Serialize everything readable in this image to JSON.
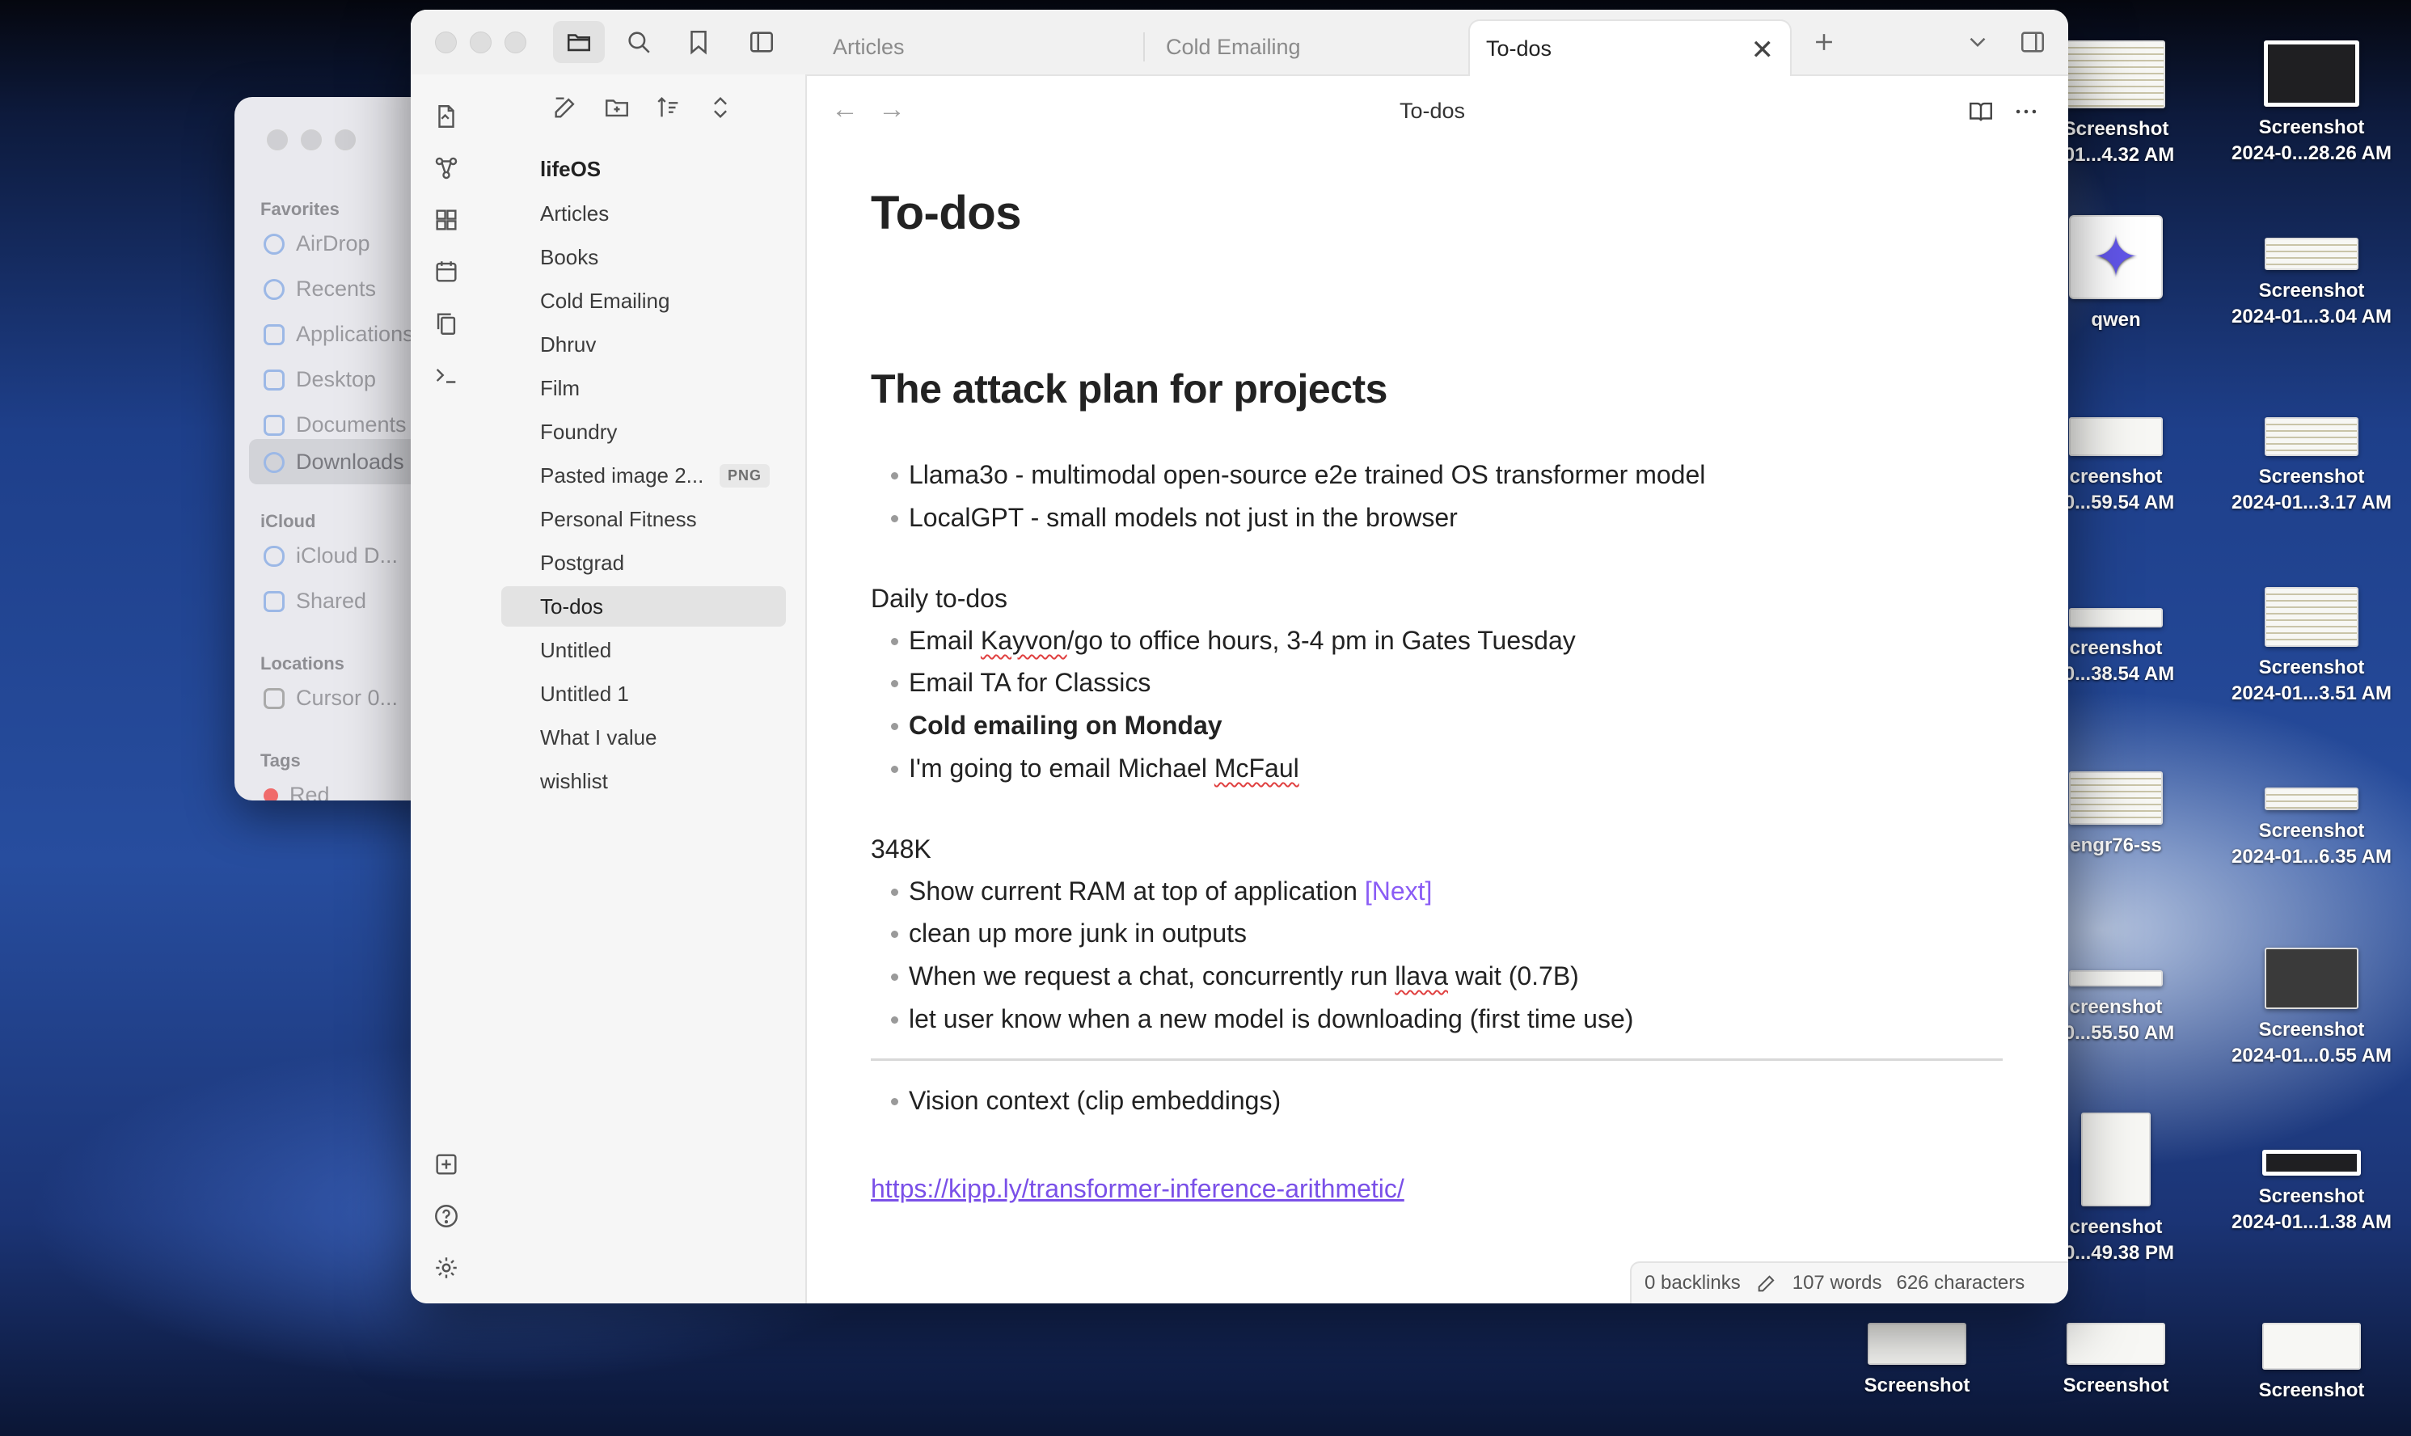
{
  "finder": {
    "sections": {
      "favorites": "Favorites",
      "icloud": "iCloud",
      "locations": "Locations",
      "tags": "Tags"
    },
    "items": {
      "airdrop": "AirDrop",
      "recents": "Recents",
      "applications": "Applications",
      "desktop": "Desktop",
      "documents": "Documents",
      "downloads": "Downloads",
      "icloud_drive": "iCloud D...",
      "shared": "Shared",
      "cursor": "Cursor 0...",
      "red": "Red"
    }
  },
  "desktop_icons": [
    {
      "line1": "Screenshot",
      "line2": "-01...4.32 AM"
    },
    {
      "line1": "Screenshot",
      "line2": "2024-0...28.26 AM"
    },
    {
      "line1": "qwen",
      "line2": ""
    },
    {
      "line1": "Screenshot",
      "line2": "2024-01...3.04 AM"
    },
    {
      "line1": "creenshot",
      "line2": "-0...59.54 AM"
    },
    {
      "line1": "Screenshot",
      "line2": "2024-01...3.17 AM"
    },
    {
      "line1": "creenshot",
      "line2": "-0...38.54 AM"
    },
    {
      "line1": "Screenshot",
      "line2": "2024-01...3.51 AM"
    },
    {
      "line1": "engr76-ss",
      "line2": ""
    },
    {
      "line1": "Screenshot",
      "line2": "2024-01...6.35 AM"
    },
    {
      "line1": "creenshot",
      "line2": "-0...55.50 AM"
    },
    {
      "line1": "Screenshot",
      "line2": "2024-01...0.55 AM"
    },
    {
      "line1": "creenshot",
      "line2": "-0...49.38 PM"
    },
    {
      "line1": "Screenshot",
      "line2": "2024-01...1.38 AM"
    },
    {
      "line1": "Screenshot",
      "line2": ""
    },
    {
      "line1": "Screenshot",
      "line2": ""
    },
    {
      "line1": "Screenshot",
      "line2": ""
    }
  ],
  "tabs": [
    {
      "label": "Articles"
    },
    {
      "label": "Cold Emailing"
    },
    {
      "label": "To-dos"
    }
  ],
  "explorer": {
    "vault_name": "lifeOS",
    "files": [
      {
        "name": "Articles"
      },
      {
        "name": "Books"
      },
      {
        "name": "Cold Emailing"
      },
      {
        "name": "Dhruv"
      },
      {
        "name": "Film"
      },
      {
        "name": "Foundry"
      },
      {
        "name": "Pasted image 2...",
        "badge": "PNG"
      },
      {
        "name": "Personal Fitness"
      },
      {
        "name": "Postgrad"
      },
      {
        "name": "To-dos"
      },
      {
        "name": "Untitled"
      },
      {
        "name": "Untitled 1"
      },
      {
        "name": "What I value"
      },
      {
        "name": "wishlist"
      }
    ]
  },
  "note": {
    "view_title": "To-dos",
    "title": "To-dos",
    "heading": "The attack plan for projects",
    "projects": [
      "Llama3o - multimodal open-source e2e trained OS transformer model",
      "LocalGPT - small models not just in the browser"
    ],
    "daily_label": "Daily to-dos",
    "daily": {
      "email_pre": "Email ",
      "email_name": "Kayvon",
      "email_post": "/go to office hours, 3-4 pm in Gates Tuesday",
      "ta": "Email TA for Classics",
      "cold": "Cold emailing on Monday",
      "michael_pre": "I'm going to email Michael ",
      "michael_name": "McFaul"
    },
    "k_label": "348K",
    "k_items": {
      "ram_pre": "Show current RAM at top of application ",
      "ram_tag": "[Next]",
      "junk": "clean up more junk in outputs",
      "chat_pre": "When we request a chat, concurrently run ",
      "chat_word": "llava",
      "chat_post": " wait (0.7B)",
      "download": "let user know when a new model is downloading (first time use)"
    },
    "vision": "Vision context (clip embeddings)",
    "link": "https://kipp.ly/transformer-inference-arithmetic/"
  },
  "status": {
    "backlinks": "0 backlinks",
    "words": "107 words",
    "characters": "626 characters"
  }
}
